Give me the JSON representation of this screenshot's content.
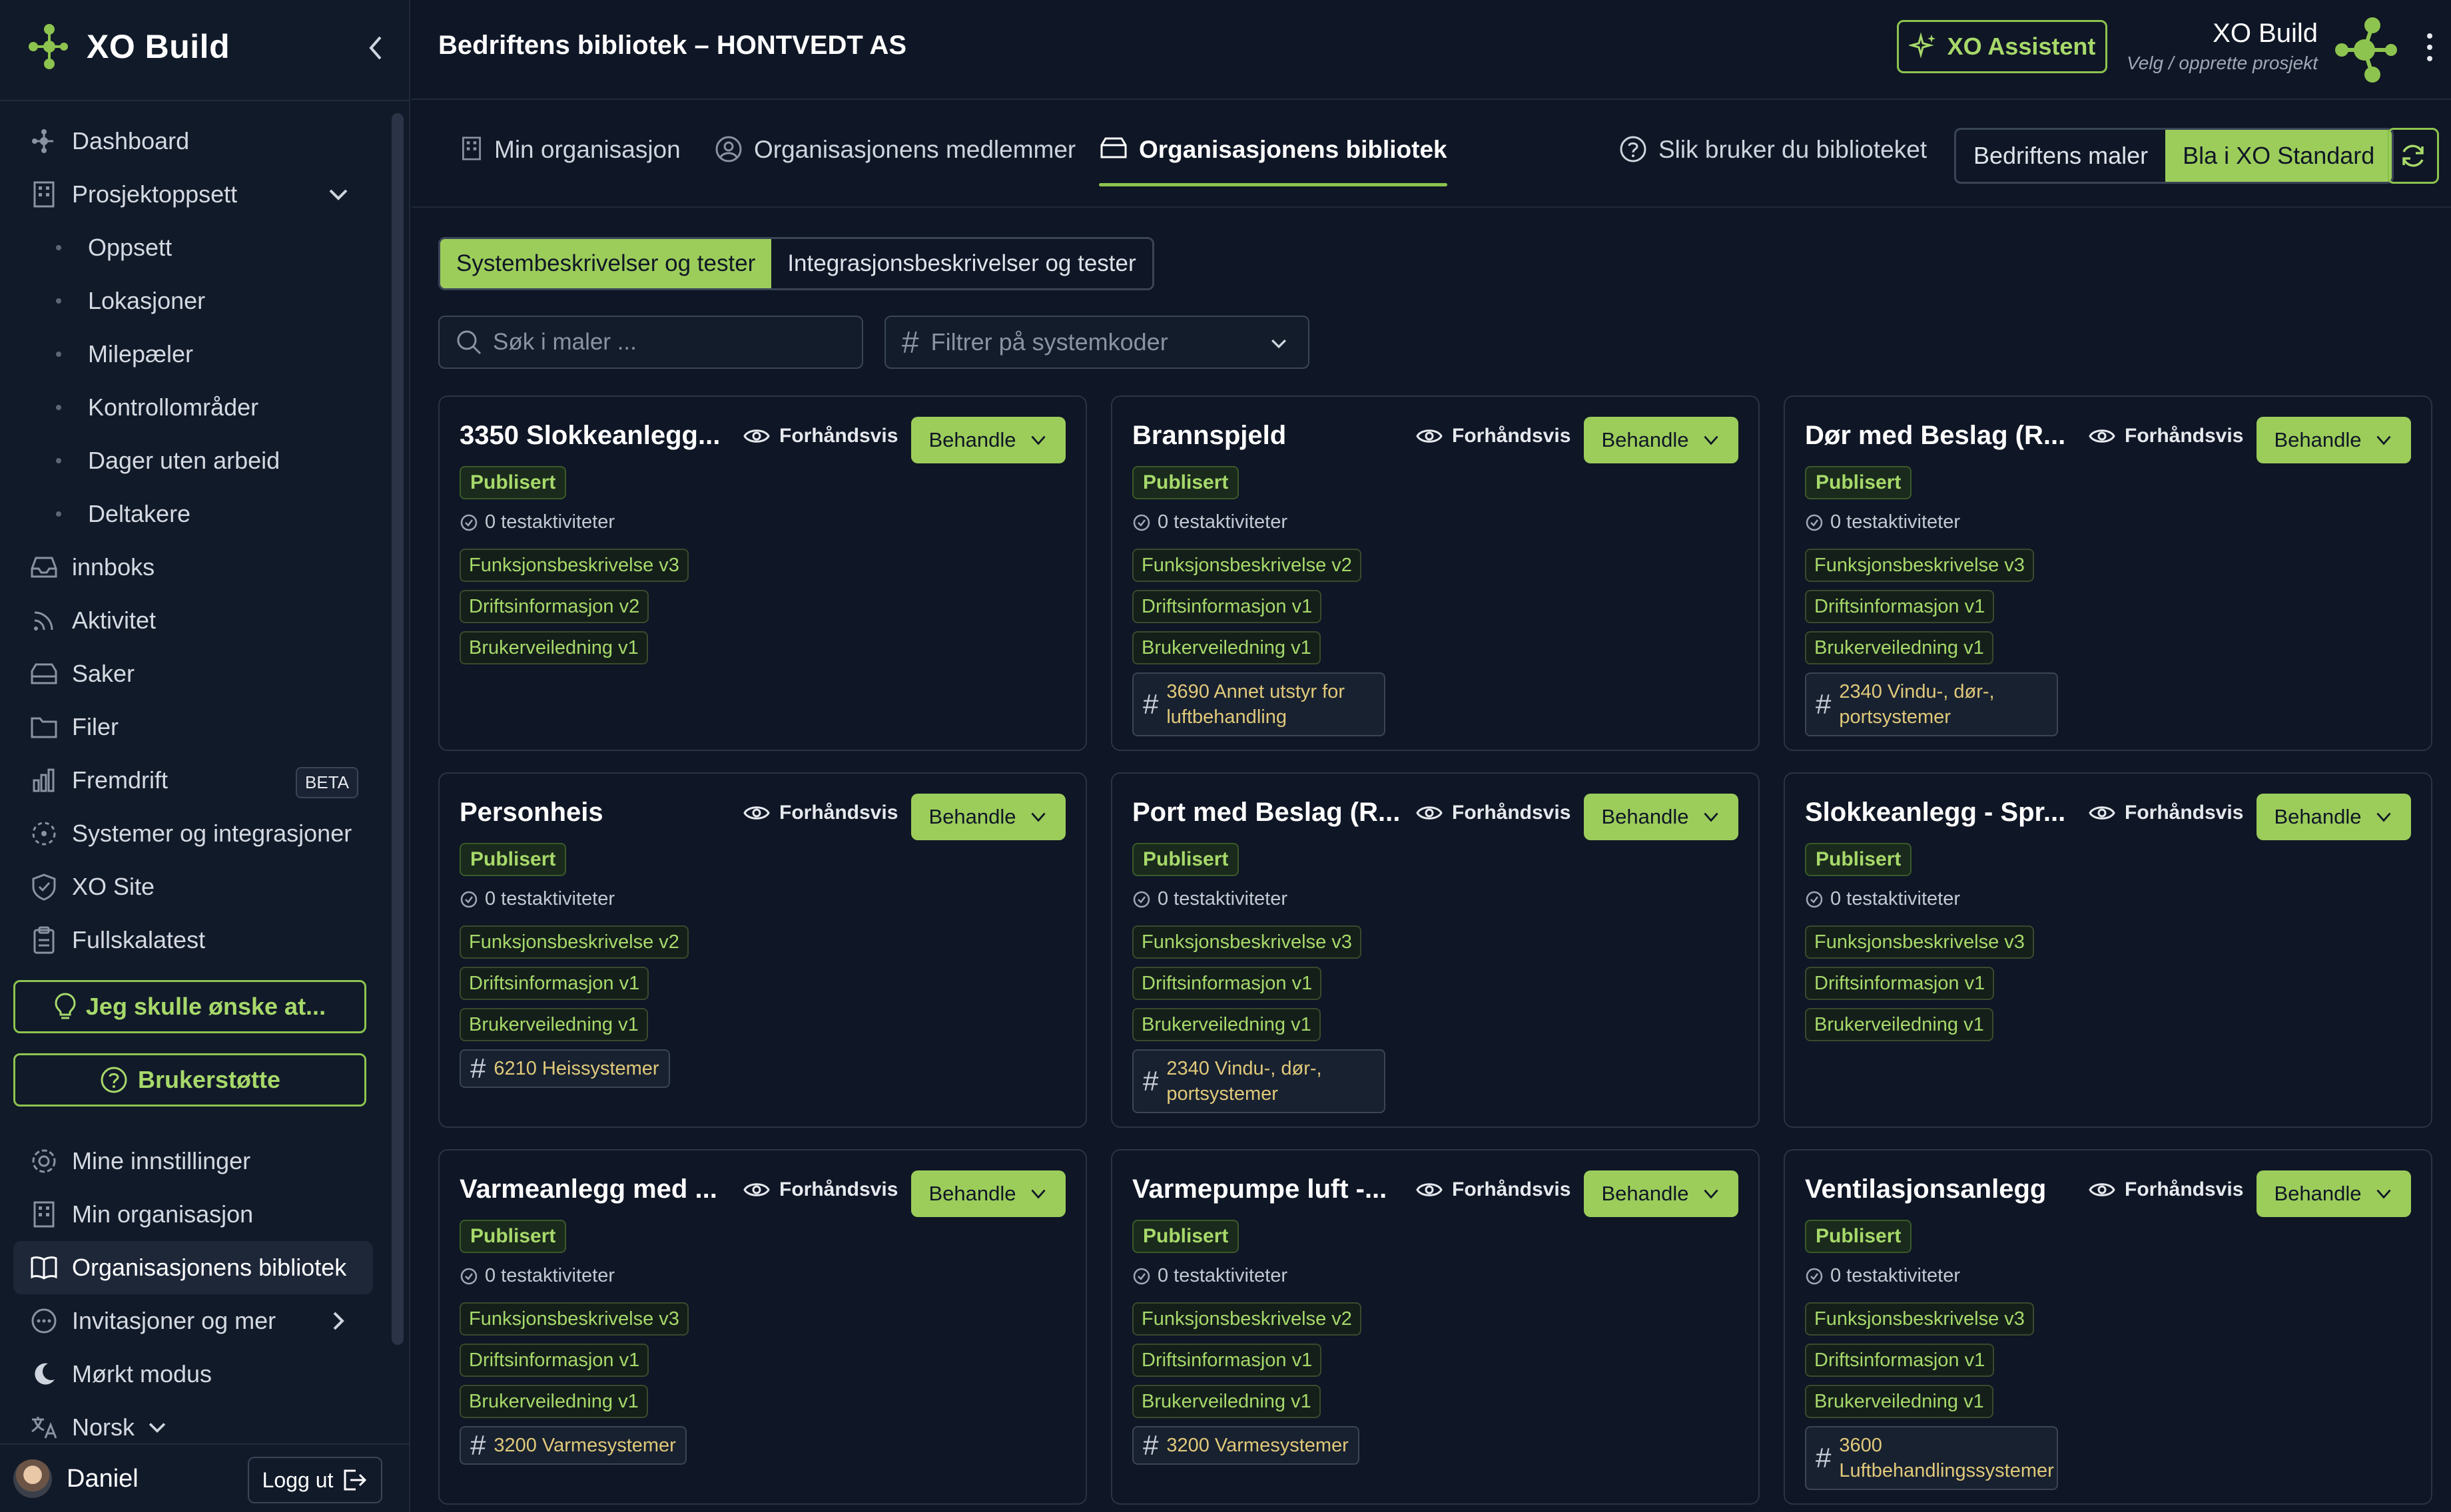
{
  "brand": {
    "name": "XO Build"
  },
  "header": {
    "title": "Bedriftens bibliotek – HONTVEDT AS",
    "assistant_label": "XO Assistent",
    "project_name": "XO Build",
    "project_sub": "Velg / opprette prosjekt"
  },
  "sidebar": {
    "items": [
      {
        "label": "Dashboard",
        "icon": "dashboard-icon"
      },
      {
        "label": "Prosjektoppsett",
        "icon": "building-icon"
      },
      {
        "label": "Oppsett"
      },
      {
        "label": "Lokasjoner"
      },
      {
        "label": "Milepæler"
      },
      {
        "label": "Kontrollområder"
      },
      {
        "label": "Dager uten arbeid"
      },
      {
        "label": "Deltakere"
      },
      {
        "label": "innboks",
        "icon": "inbox-icon"
      },
      {
        "label": "Aktivitet",
        "icon": "activity-icon"
      },
      {
        "label": "Saker",
        "icon": "cases-icon"
      },
      {
        "label": "Filer",
        "icon": "folder-icon"
      },
      {
        "label": "Fremdrift",
        "icon": "progress-icon",
        "badge": "BETA"
      },
      {
        "label": "Systemer og integrasjoner",
        "icon": "systems-icon"
      },
      {
        "label": "XO Site",
        "icon": "shield-icon"
      },
      {
        "label": "Fullskalatest",
        "icon": "clipboard-icon"
      }
    ],
    "wish_label": "Jeg skulle ønske at...",
    "support_label": "Brukerstøtte",
    "bottom": [
      {
        "label": "Mine innstillinger",
        "icon": "gear-icon"
      },
      {
        "label": "Min organisasjon",
        "icon": "building-icon"
      },
      {
        "label": "Organisasjonens bibliotek",
        "icon": "book-icon"
      },
      {
        "label": "Invitasjoner og mer",
        "icon": "more-icon"
      },
      {
        "label": "Mørkt modus",
        "icon": "moon-icon"
      },
      {
        "label": "Norsk",
        "icon": "language-icon"
      }
    ],
    "user_name": "Daniel",
    "logout_label": "Logg ut"
  },
  "tabs": {
    "items": [
      "Min organisasjon",
      "Organisasjonens medlemmer",
      "Organisasjonens bibliotek"
    ],
    "help": "Slik bruker du biblioteket",
    "toggle": [
      "Bedriftens maler",
      "Bla i XO Standard"
    ]
  },
  "library": {
    "segments": [
      "Systembeskrivelser og tester",
      "Integrasjonsbeskrivelser og tester"
    ],
    "search_placeholder": "Søk i maler ...",
    "filter_placeholder": "Filtrer på systemkoder",
    "preview_label": "Forhåndsvis",
    "handle_label": "Behandle",
    "cards": [
      {
        "title": "3350 Slokkeanlegg...",
        "status": "Publisert",
        "tests": "0 testaktiviteter",
        "docs": [
          "Funksjonsbeskrivelse v3",
          "Driftsinformasjon v2",
          "Brukerveiledning v1"
        ],
        "code": ""
      },
      {
        "title": "Brannspjeld",
        "status": "Publisert",
        "tests": "0 testaktiviteter",
        "docs": [
          "Funksjonsbeskrivelse v2",
          "Driftsinformasjon v1",
          "Brukerveiledning v1"
        ],
        "code": "3690 Annet utstyr for luftbehandling"
      },
      {
        "title": "Dør med Beslag (R...",
        "status": "Publisert",
        "tests": "0 testaktiviteter",
        "docs": [
          "Funksjonsbeskrivelse v3",
          "Driftsinformasjon v1",
          "Brukerveiledning v1"
        ],
        "code": "2340 Vindu-, dør-, portsystemer"
      },
      {
        "title": "Personheis",
        "status": "Publisert",
        "tests": "0 testaktiviteter",
        "docs": [
          "Funksjonsbeskrivelse v2",
          "Driftsinformasjon v1",
          "Brukerveiledning v1"
        ],
        "code": "6210 Heissystemer"
      },
      {
        "title": "Port med Beslag (R...",
        "status": "Publisert",
        "tests": "0 testaktiviteter",
        "docs": [
          "Funksjonsbeskrivelse v3",
          "Driftsinformasjon v1",
          "Brukerveiledning v1"
        ],
        "code": "2340 Vindu-, dør-, portsystemer"
      },
      {
        "title": "Slokkeanlegg - Spr...",
        "status": "Publisert",
        "tests": "0 testaktiviteter",
        "docs": [
          "Funksjonsbeskrivelse v3",
          "Driftsinformasjon v1",
          "Brukerveiledning v1"
        ],
        "code": ""
      },
      {
        "title": "Varmeanlegg med ...",
        "status": "Publisert",
        "tests": "0 testaktiviteter",
        "docs": [
          "Funksjonsbeskrivelse v3",
          "Driftsinformasjon v1",
          "Brukerveiledning v1"
        ],
        "code": "3200 Varmesystemer"
      },
      {
        "title": "Varmepumpe luft -...",
        "status": "Publisert",
        "tests": "0 testaktiviteter",
        "docs": [
          "Funksjonsbeskrivelse v2",
          "Driftsinformasjon v1",
          "Brukerveiledning v1"
        ],
        "code": "3200 Varmesystemer"
      },
      {
        "title": "Ventilasjonsanlegg",
        "status": "Publisert",
        "tests": "0 testaktiviteter",
        "docs": [
          "Funksjonsbeskrivelse v3",
          "Driftsinformasjon v1",
          "Brukerveiledning v1"
        ],
        "code": "3600 Luftbehandlingssystemer"
      }
    ]
  },
  "colors": {
    "accent": "#9ccd5b",
    "background": "#0f1625",
    "sidebar": "#111a29",
    "code_text": "#e0c97a"
  }
}
